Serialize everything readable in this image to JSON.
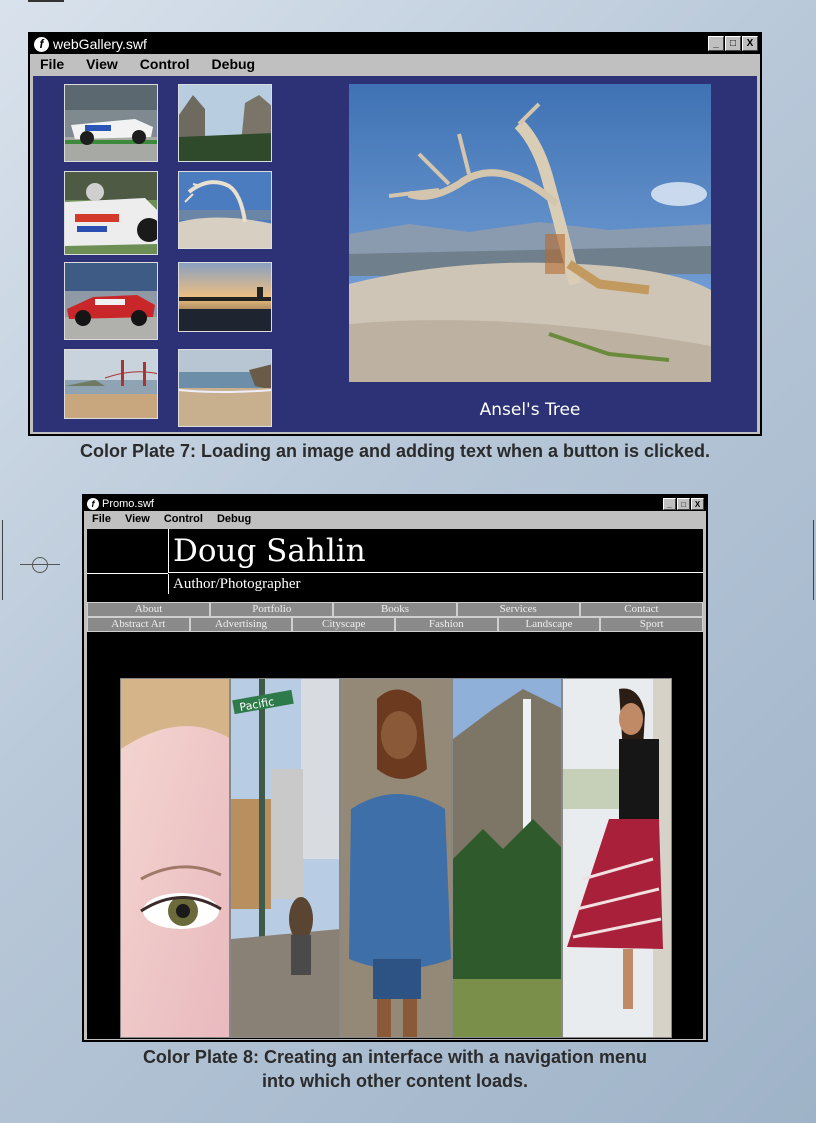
{
  "plate7": {
    "window_title": "webGallery.swf",
    "flash_glyph": "f",
    "controls": [
      "_",
      "□",
      "X"
    ],
    "menu": [
      "File",
      "View",
      "Control",
      "Debug"
    ],
    "thumbnails": [
      "race car 1",
      "race car 2",
      "race car 3",
      "golden gate",
      "yosemite valley",
      "tree on rock",
      "sunset lake",
      "beach"
    ],
    "caption": "Ansel's Tree",
    "plate_caption": "Color Plate 7: Loading an image and adding text when a button is clicked."
  },
  "plate8": {
    "window_title": "Promo.swf",
    "flash_glyph": "f",
    "controls": [
      "_",
      "□",
      "X"
    ],
    "menu": [
      "File",
      "View",
      "Control",
      "Debug"
    ],
    "name": "Doug Sahlin",
    "subtitle": "Author/Photographer",
    "nav_row1": [
      "About",
      "Portfolio",
      "Books",
      "Services",
      "Contact"
    ],
    "nav_row2": [
      "Abstract Art",
      "Advertising",
      "Cityscape",
      "Fashion",
      "Landscape",
      "Sport"
    ],
    "sign_text": "Pacific",
    "plate_caption_line1": "Color Plate 8: Creating an interface with a navigation menu",
    "plate_caption_line2": "into which other content loads."
  },
  "colors": {
    "gallery_bg": "#2c3275",
    "promo_bg": "#000000",
    "nav_button": "#8a8a8a"
  }
}
